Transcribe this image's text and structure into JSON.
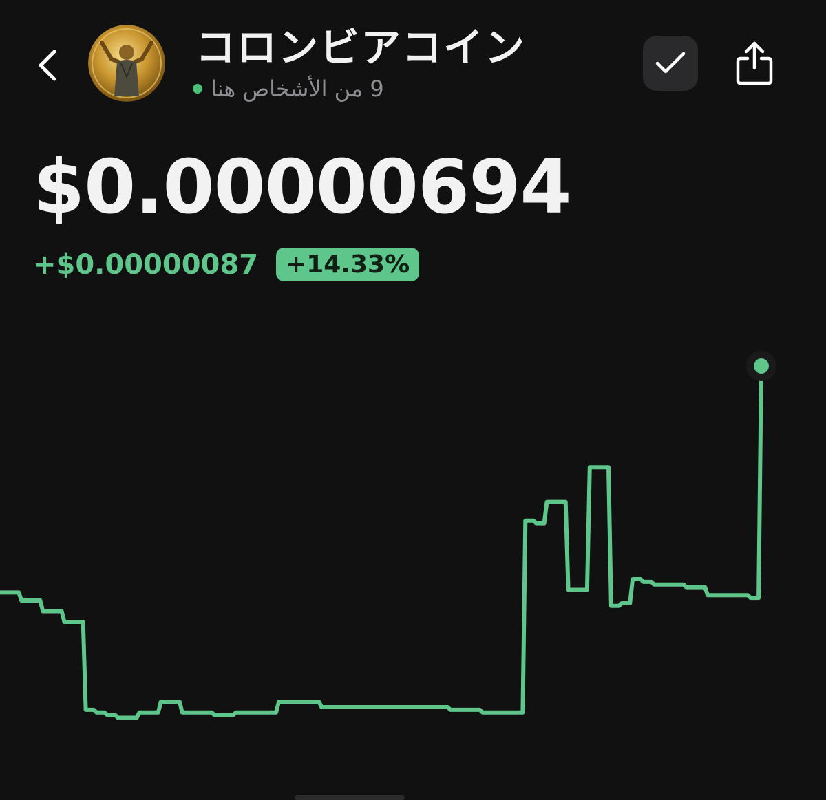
{
  "header": {
    "back_icon": "chevron-left-icon",
    "title": "コロンビアコイン",
    "online_text": "9 من الأشخاص هنا",
    "online_color": "#4cc07a",
    "check_icon": "checkmark-icon",
    "share_icon": "share-icon"
  },
  "price": {
    "value": "$0.00000694",
    "change_abs": "+$0.00000087",
    "change_pct": "+14.33%",
    "positive_color": "#5ec68a"
  },
  "chart_data": {
    "type": "line",
    "title": "",
    "xlabel": "",
    "ylabel": "",
    "grid": false,
    "legend": "none",
    "line_color": "#5ec68a",
    "y_unit": "USD",
    "ylim": [
      5.5e-06,
      7.1e-06
    ],
    "values": [
      6.09e-06,
      6.09e-06,
      6.06e-06,
      6.06e-06,
      6.02e-06,
      6.02e-06,
      5.98e-06,
      5.98e-06,
      5.65e-06,
      5.64e-06,
      5.63e-06,
      5.62e-06,
      5.62e-06,
      5.64e-06,
      5.64e-06,
      5.68e-06,
      5.68e-06,
      5.64e-06,
      5.64e-06,
      5.64e-06,
      5.63e-06,
      5.63e-06,
      5.64e-06,
      5.64e-06,
      5.64e-06,
      5.64e-06,
      5.68e-06,
      5.68e-06,
      5.68e-06,
      5.68e-06,
      5.66e-06,
      5.66e-06,
      5.66e-06,
      5.66e-06,
      5.66e-06,
      5.66e-06,
      5.66e-06,
      5.66e-06,
      5.66e-06,
      5.66e-06,
      5.66e-06,
      5.66e-06,
      5.65e-06,
      5.65e-06,
      5.65e-06,
      5.64e-06,
      5.64e-06,
      5.64e-06,
      5.64e-06,
      6.36e-06,
      6.35e-06,
      6.43e-06,
      6.43e-06,
      6.1e-06,
      6.1e-06,
      6.56e-06,
      6.56e-06,
      6.04e-06,
      6.05e-06,
      6.14e-06,
      6.13e-06,
      6.12e-06,
      6.12e-06,
      6.12e-06,
      6.11e-06,
      6.11e-06,
      6.08e-06,
      6.08e-06,
      6.08e-06,
      6.08e-06,
      6.07e-06,
      6.94e-06
    ]
  }
}
